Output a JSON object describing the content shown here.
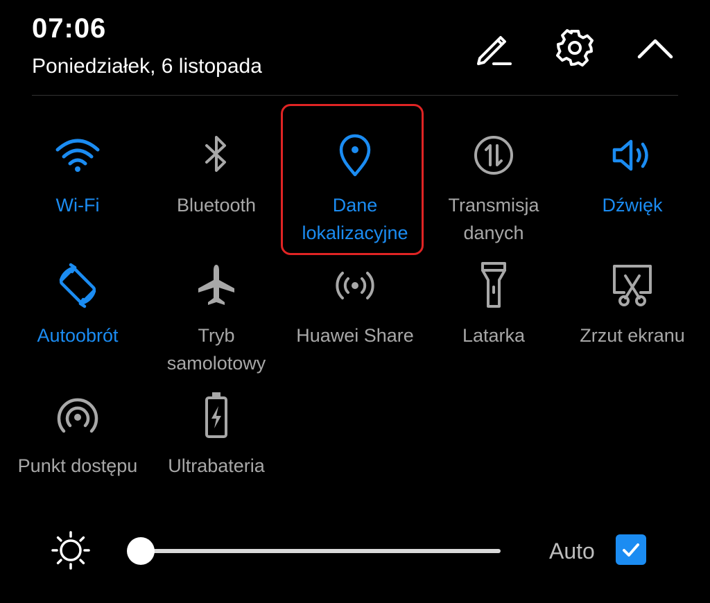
{
  "status": {
    "time": "07:06",
    "date": "Poniedziałek, 6 listopada"
  },
  "header_icons": [
    "edit-icon",
    "settings-gear-icon",
    "collapse-chevron-up-icon"
  ],
  "tiles": [
    {
      "label": "Wi-Fi",
      "icon": "wifi-icon",
      "active": true
    },
    {
      "label": "Bluetooth",
      "icon": "bluetooth-icon",
      "active": false
    },
    {
      "label": "Dane\nlokalizacyjne",
      "icon": "location-pin-icon",
      "active": true,
      "highlighted": true
    },
    {
      "label": "Transmisja\ndanych",
      "icon": "mobile-data-icon",
      "active": false
    },
    {
      "label": "Dźwięk",
      "icon": "sound-icon",
      "active": true
    },
    {
      "label": "Autoobrót",
      "icon": "auto-rotate-icon",
      "active": true
    },
    {
      "label": "Tryb\nsamolotowy",
      "icon": "airplane-icon",
      "active": false
    },
    {
      "label": "Huawei Share",
      "icon": "huawei-share-icon",
      "active": false
    },
    {
      "label": "Latarka",
      "icon": "flashlight-icon",
      "active": false
    },
    {
      "label": "Zrzut ekranu",
      "icon": "screenshot-icon",
      "active": false
    },
    {
      "label": "Punkt dostępu",
      "icon": "hotspot-icon",
      "active": false
    },
    {
      "label": "Ultrabateria",
      "icon": "battery-saver-icon",
      "active": false
    }
  ],
  "brightness": {
    "icon": "brightness-sun-icon",
    "level": 0.02,
    "auto_label": "Auto",
    "auto_checked": true
  },
  "colors": {
    "active": "#1b8cf2",
    "inactive": "#a8a8a8",
    "highlight_border": "#e02424",
    "background": "#000000"
  }
}
